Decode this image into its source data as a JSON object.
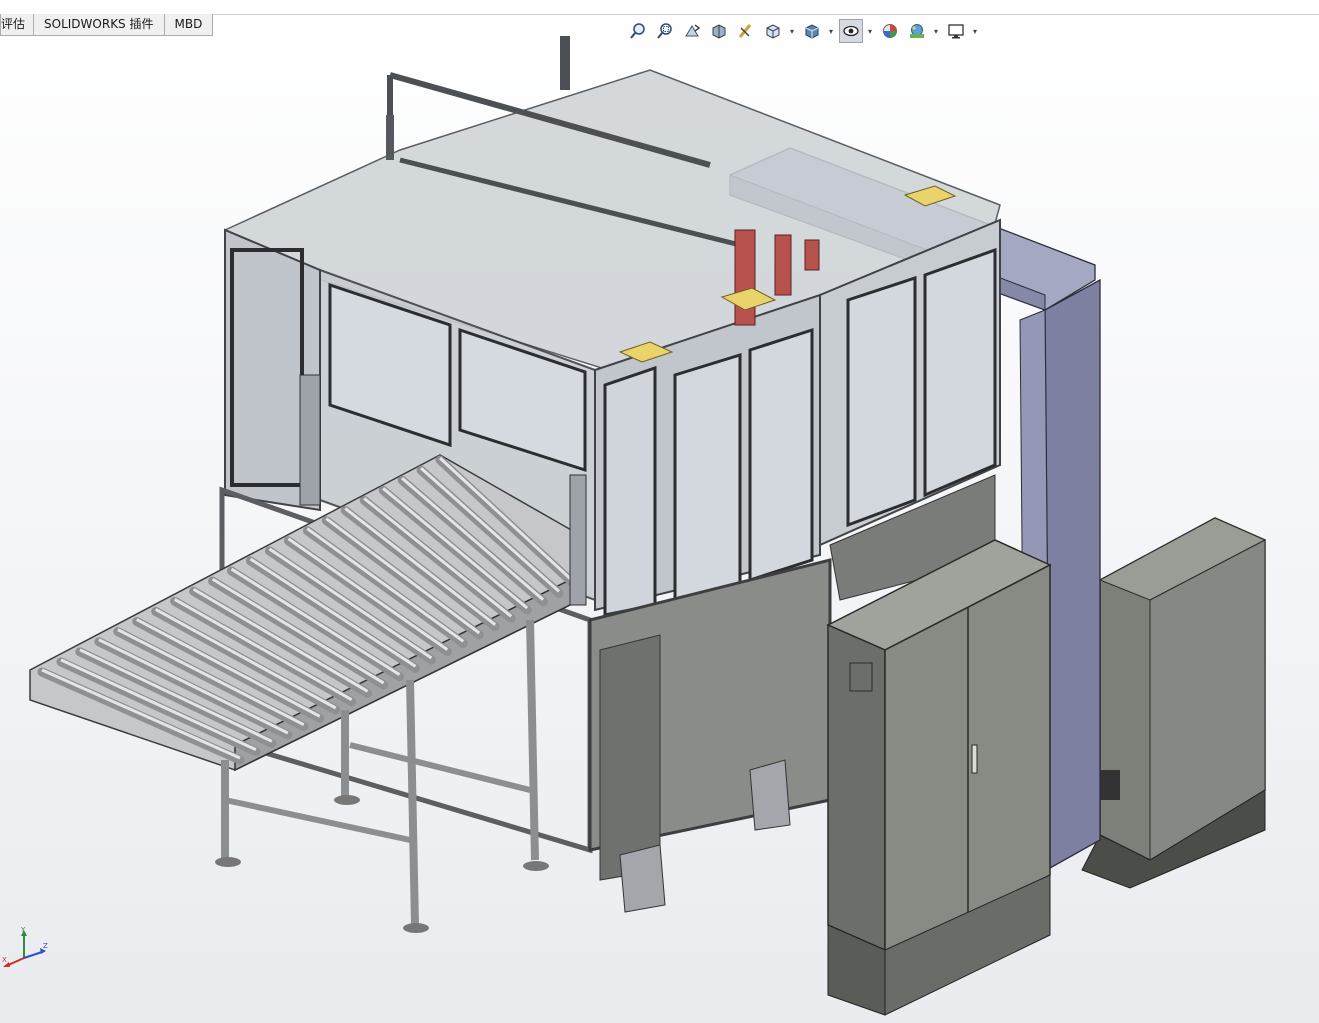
{
  "tabs": [
    {
      "label": "评估"
    },
    {
      "label": "SOLIDWORKS 插件"
    },
    {
      "label": "MBD"
    }
  ],
  "toolbar": {
    "buttons": [
      {
        "name": "zoom-to-fit-icon"
      },
      {
        "name": "zoom-to-area-icon"
      },
      {
        "name": "previous-view-icon"
      },
      {
        "name": "section-view-icon"
      },
      {
        "name": "dynamic-annotation-icon"
      },
      {
        "name": "view-orientation-icon"
      },
      {
        "name": "display-style-icon"
      },
      {
        "name": "hide-show-items-icon"
      },
      {
        "name": "edit-appearance-icon"
      },
      {
        "name": "apply-scene-icon"
      },
      {
        "name": "view-settings-icon"
      }
    ]
  },
  "triad": {
    "x_label": "X",
    "y_label": "Y",
    "z_label": "Z"
  },
  "colors": {
    "frame": "#5a5d61",
    "glass": "#c9d0d6",
    "panel_blue": "#8e92ad",
    "cabinet": "#7f827c",
    "accent_red": "#b8524f",
    "accent_yellow": "#e9d36a",
    "conveyor": "#b7b9bc"
  }
}
